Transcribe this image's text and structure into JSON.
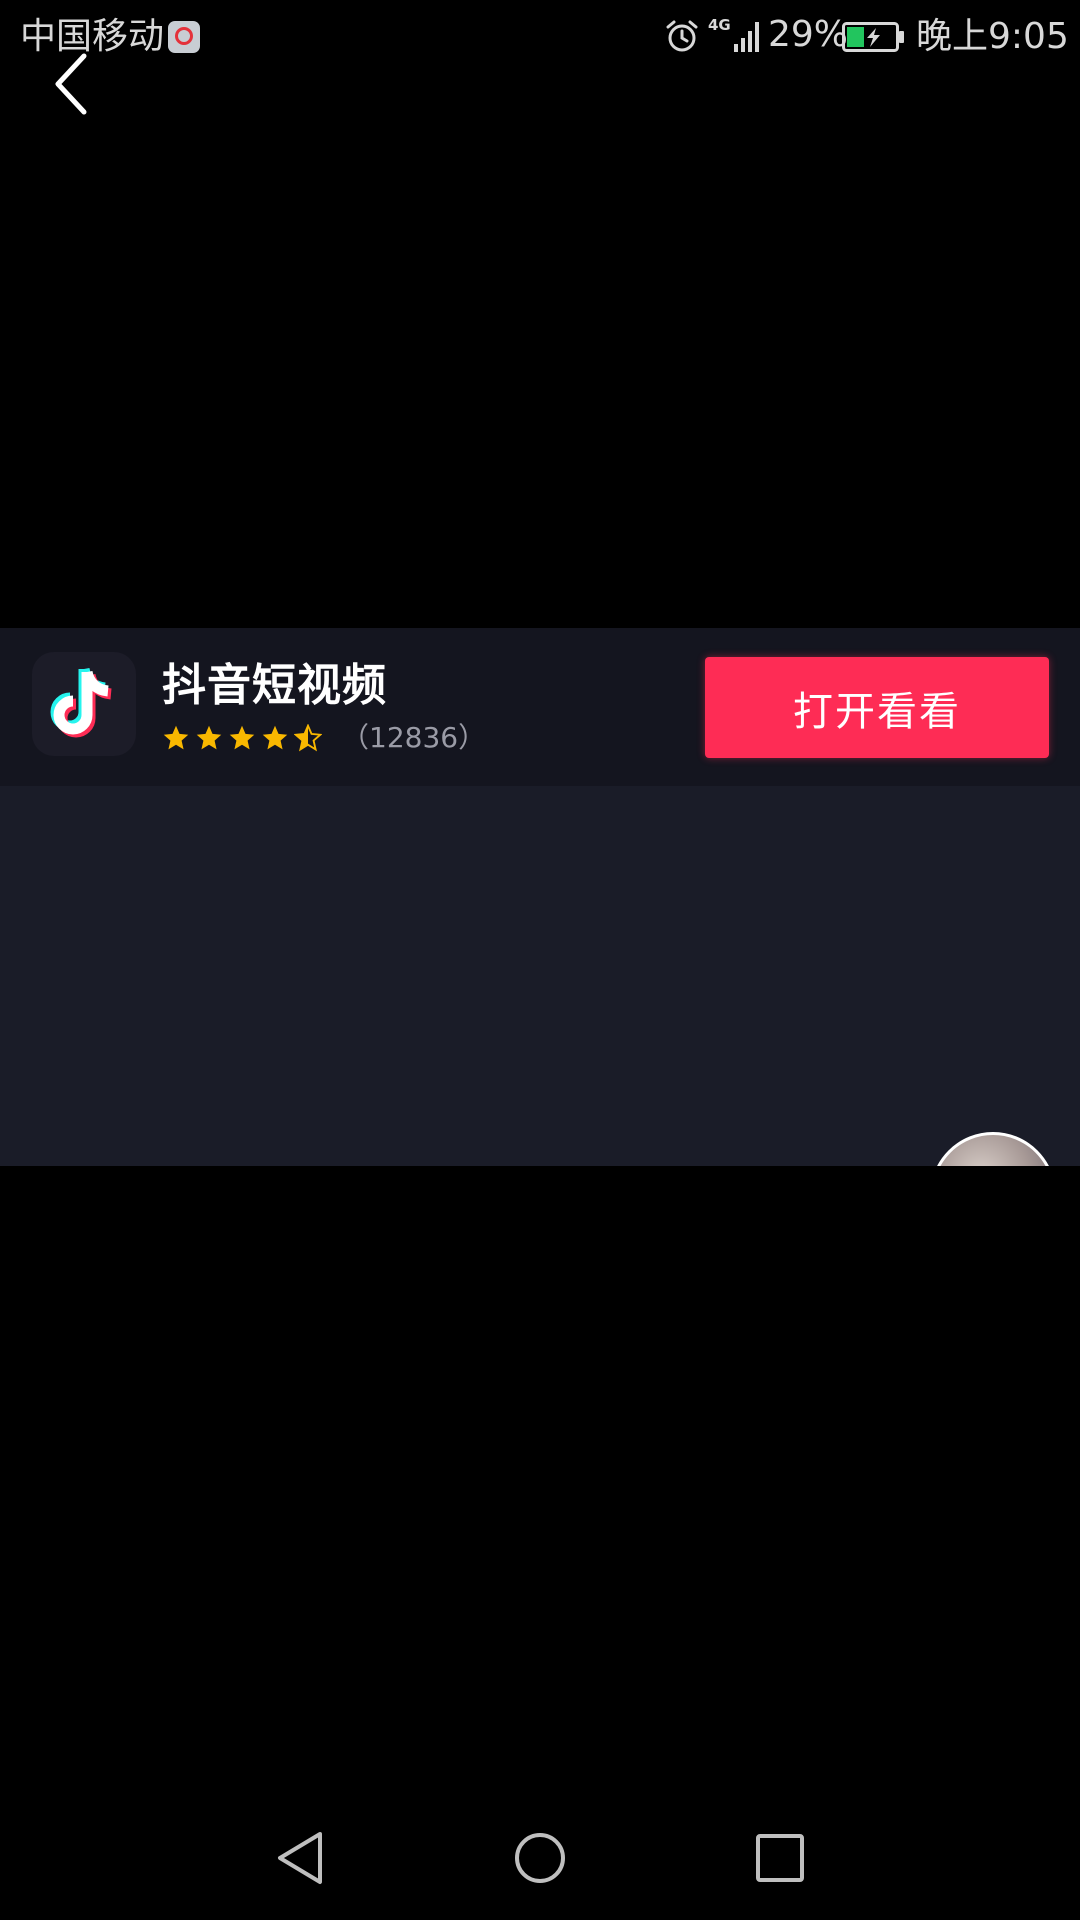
{
  "status_bar": {
    "carrier": "中国移动",
    "network": "4G",
    "battery_percent": "29%",
    "time": "晚上9:05",
    "icons": [
      "carrier-app-icon",
      "alarm-icon",
      "signal-icon",
      "battery-charging-icon"
    ]
  },
  "header": {
    "back_icon": "chevron-left-icon"
  },
  "app_banner": {
    "app_name": "抖音短视频",
    "rating_value": 4.5,
    "rating_max": 5,
    "rating_count": "（12836）",
    "open_button_label": "打开看看",
    "colors": {
      "button": "#fe2c55",
      "star": "#f9b800",
      "banner_bg": "#14151f"
    }
  },
  "video": {
    "background": "#1a1c28",
    "avatar_icon": "user-avatar"
  },
  "nav_bar": {
    "icons": [
      "nav-back-icon",
      "nav-home-icon",
      "nav-recents-icon"
    ]
  }
}
